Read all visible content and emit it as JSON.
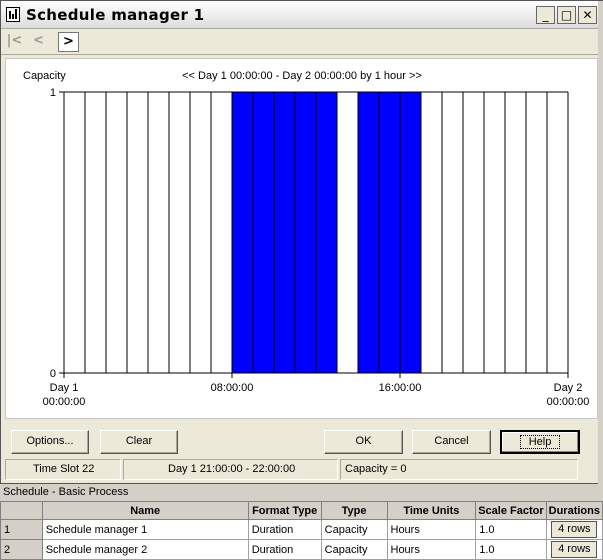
{
  "window": {
    "title": "Schedule manager 1",
    "minimize_glyph": "_",
    "maximize_glyph": "□",
    "close_glyph": "✕"
  },
  "toolbar": {
    "first_glyph": "|<",
    "prev_glyph": "<",
    "next_glyph": ">"
  },
  "chart_header": {
    "capacity_label": "Capacity",
    "range_label": "<< Day 1  00:00:00 - Day 2  00:00:00  by 1 hour >>"
  },
  "chart_data": {
    "type": "bar",
    "y_axis_label": "Capacity",
    "ylim": [
      0,
      1
    ],
    "y_ticks": [
      "0",
      "1"
    ],
    "x_ticks": [
      {
        "label": [
          "Day 1",
          "00:00:00"
        ],
        "hour": 0
      },
      {
        "label": [
          "08:00:00"
        ],
        "hour": 8
      },
      {
        "label": [
          "16:00:00"
        ],
        "hour": 16
      },
      {
        "label": [
          "Day 2",
          "00:00:00"
        ],
        "hour": 24
      }
    ],
    "hours": [
      "00",
      "01",
      "02",
      "03",
      "04",
      "05",
      "06",
      "07",
      "08",
      "09",
      "10",
      "11",
      "12",
      "13",
      "14",
      "15",
      "16",
      "17",
      "18",
      "19",
      "20",
      "21",
      "22",
      "23"
    ],
    "values": [
      0,
      0,
      0,
      0,
      0,
      0,
      0,
      0,
      1,
      1,
      1,
      1,
      1,
      0,
      1,
      1,
      1,
      0,
      0,
      0,
      0,
      0,
      0,
      0
    ],
    "bar_color": "#0000ff",
    "grid": true
  },
  "buttons": {
    "options": "Options...",
    "clear": "Clear",
    "ok": "OK",
    "cancel": "Cancel",
    "help": "Help"
  },
  "status": {
    "slot": "Time Slot 22",
    "range": "Day 1  21:00:00 - 22:00:00",
    "capacity": "Capacity = 0"
  },
  "panel": {
    "title": "Schedule - Basic Process",
    "columns": [
      "",
      "Name",
      "Format Type",
      "Type",
      "Time Units",
      "Scale Factor",
      "Durations"
    ],
    "rows": [
      {
        "num": "1",
        "name": "Schedule manager 1",
        "format_type": "Duration",
        "type": "Capacity",
        "time_units": "Hours",
        "scale_factor": "1.0",
        "durations": "4 rows"
      },
      {
        "num": "2",
        "name": "Schedule manager 2",
        "format_type": "Duration",
        "type": "Capacity",
        "time_units": "Hours",
        "scale_factor": "1.0",
        "durations": "4 rows"
      }
    ]
  }
}
